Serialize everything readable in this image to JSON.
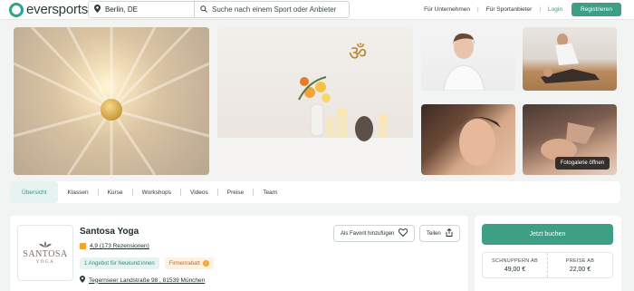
{
  "brand": {
    "name": "eversports",
    "accent": "#3e9f86"
  },
  "header": {
    "location": "Berlin, DE",
    "search_placeholder": "Suche nach einem Sport oder Anbieter",
    "links": [
      "Für Unternehmen",
      "Für Sportanbieter"
    ],
    "login": "Login",
    "register": "Registrieren"
  },
  "gallery": {
    "button": "Fotogalerie öffnen"
  },
  "tabs": [
    "Übersicht",
    "Klassen",
    "Kurse",
    "Workshops",
    "Videos",
    "Preise",
    "Team"
  ],
  "studio": {
    "logo_name": "SANTOSA",
    "logo_sub": "YOGA",
    "title": "Santosa Yoga",
    "rating": "4,9 (173 Rezensionen)",
    "badge_offer": "1 Angebot für Neukund:innen",
    "badge_discount": "Firmenrabatt",
    "address": "Tegernseer Landstraße 98 , 81539 München",
    "favorite": "Als Favorit hinzufügen",
    "share": "Teilen"
  },
  "booking": {
    "button": "Jetzt buchen",
    "trial_label": "SCHNUPPERN AB",
    "trial_price": "49,00 €",
    "price_label": "PREISE AB",
    "price_value": "22,00 €"
  }
}
